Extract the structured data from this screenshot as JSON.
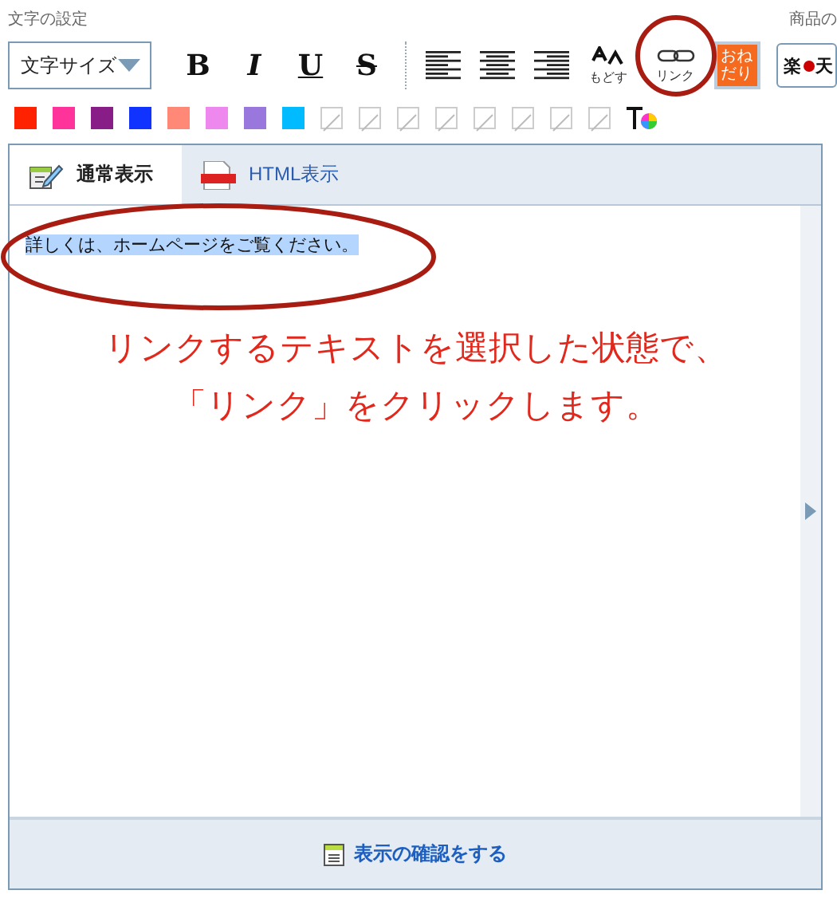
{
  "header": {
    "left_label": "文字の設定",
    "right_label": "商品の"
  },
  "toolbar": {
    "size_select": {
      "value": "文字サイズ"
    },
    "format_buttons": [
      {
        "kind": "bold",
        "label": "B"
      },
      {
        "kind": "italic",
        "label": "I"
      },
      {
        "kind": "underline",
        "label": "U"
      },
      {
        "kind": "strike",
        "label": "S"
      }
    ],
    "align_buttons": [
      {
        "kind": "left"
      },
      {
        "kind": "center"
      },
      {
        "kind": "right"
      }
    ],
    "reset_button": {
      "label": "もどす"
    },
    "link_button": {
      "label": "リンク",
      "highlighted": true
    },
    "wish_button": {
      "line_1": "おね",
      "line_2": "だり"
    },
    "rakuten_button": {
      "label_1": "楽",
      "label_2": "天"
    }
  },
  "swatches": [
    {
      "kind": "color",
      "color": "#ff2200"
    },
    {
      "kind": "color",
      "color": "#ff3399"
    },
    {
      "kind": "color",
      "color": "#881d88"
    },
    {
      "kind": "color",
      "color": "#1133ff"
    },
    {
      "kind": "color",
      "color": "#ff8877"
    },
    {
      "kind": "color",
      "color": "#ee88ee"
    },
    {
      "kind": "color",
      "color": "#9977dd"
    },
    {
      "kind": "color",
      "color": "#00bbff"
    },
    {
      "kind": "empty"
    },
    {
      "kind": "empty"
    },
    {
      "kind": "empty"
    },
    {
      "kind": "empty"
    },
    {
      "kind": "empty"
    },
    {
      "kind": "empty"
    },
    {
      "kind": "empty"
    },
    {
      "kind": "empty"
    }
  ],
  "editor": {
    "tabs": [
      {
        "label": "通常表示",
        "kind": "normal",
        "selected": true
      },
      {
        "label": "HTML表示",
        "kind": "html",
        "selected": false
      }
    ],
    "content": "詳しくは、ホームページをご覧ください。",
    "content_selected": true,
    "footer_button": "表示の確認をする"
  },
  "annotation": {
    "lines": [
      "リンクするテキストを選択した状態で、",
      "「リンク」をクリックします。"
    ]
  }
}
